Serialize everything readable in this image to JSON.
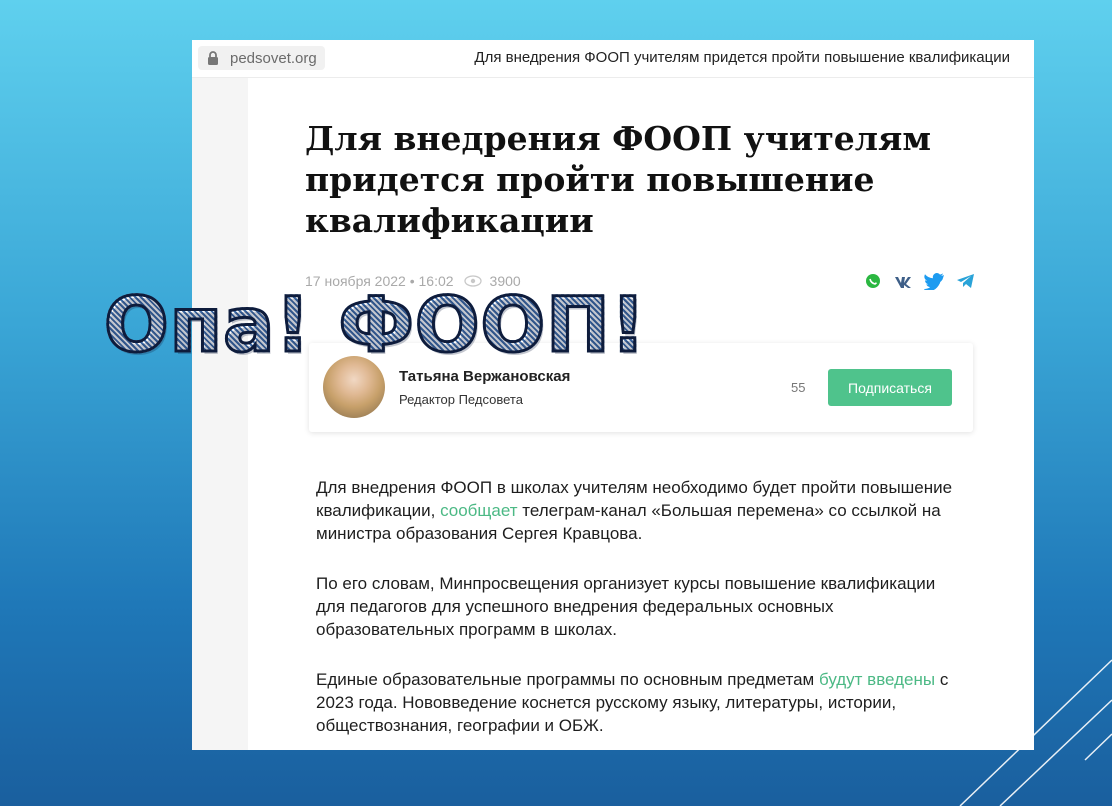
{
  "browser": {
    "url": "pedsovet.org",
    "tab_title": "Для внедрения ФООП учителям придется пройти повышение квалификации"
  },
  "article": {
    "title_line1": "Для внедрения ФООП учителям",
    "title_line2": "придется пройти повышение",
    "title_line3": "квалификации",
    "date": "17 ноября 2022 • 16:02",
    "views": "3900",
    "share_icons": [
      "whatsapp-icon",
      "vk-icon",
      "twitter-icon",
      "telegram-icon"
    ]
  },
  "author": {
    "name": "Татьяна Вержановская",
    "role": "Редактор Педсовета",
    "followers": "55",
    "subscribe_label": "Подписаться"
  },
  "paragraphs": {
    "p1_a": "Для внедрения ФООП в школах учителям необходимо будет пройти повышение квалификации, ",
    "p1_link": "сообщает",
    "p1_b": " телеграм-канал «Большая перемена» со ссылкой на министра образования Сергея Кравцова.",
    "p2": "По его словам, Минпросвещения организует курсы повышение квалификации для педагогов для успешного внедрения федеральных основных образовательных программ в школах.",
    "p3_a": "Единые образовательные программы по основным предметам ",
    "p3_link": "будут введены",
    "p3_b": " с 2023 года. Нововведение коснется русскому языку, литературы, истории, обществознания, географии и ОБЖ."
  },
  "overlay": {
    "text": "Опа! ФООП!"
  },
  "colors": {
    "accent_green": "#4fc38c",
    "link_green": "#4cb985",
    "background_top": "#5fd0ee",
    "background_bottom": "#1a5f9e"
  }
}
